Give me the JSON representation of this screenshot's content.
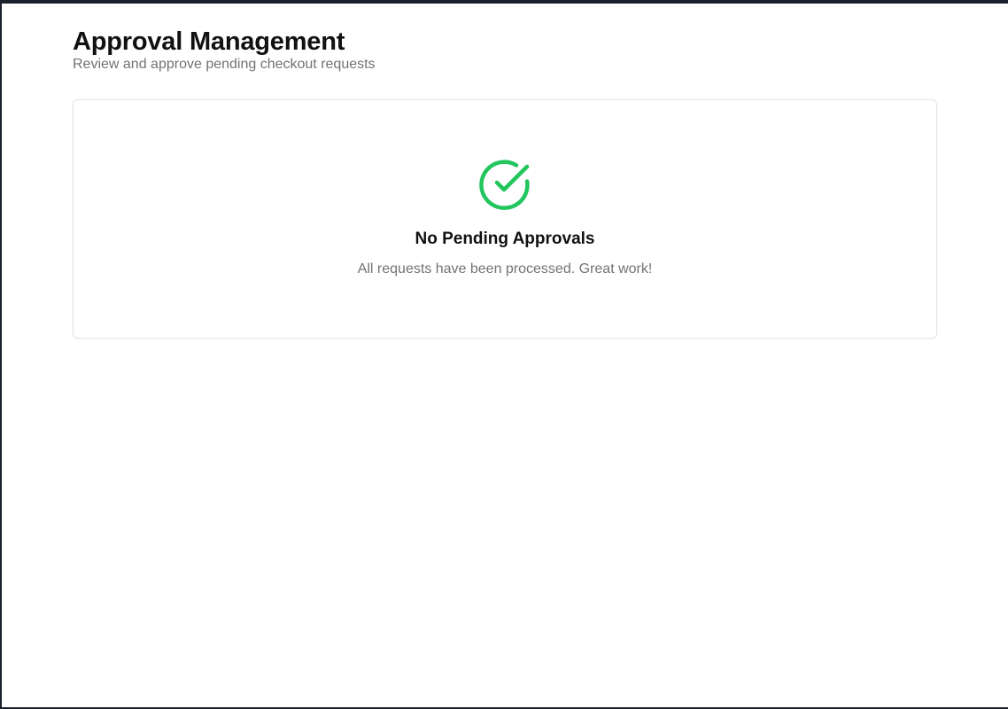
{
  "header": {
    "title": "Approval Management",
    "subtitle": "Review and approve pending checkout requests"
  },
  "empty_state": {
    "icon": "check-circle-icon",
    "title": "No Pending Approvals",
    "message": "All requests have been processed. Great work!"
  },
  "colors": {
    "success": "#22c55e",
    "heading": "#111111",
    "muted": "#737373",
    "border": "#e5e5e5"
  }
}
